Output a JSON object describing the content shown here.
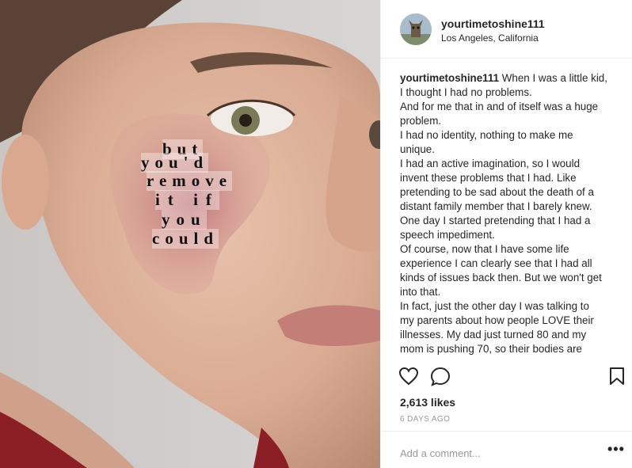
{
  "post": {
    "username": "yourtimetoshine111",
    "location": "Los Angeles, California",
    "image_overlay_words": [
      "but",
      "you'd",
      "remove",
      "it if",
      "you",
      "could"
    ],
    "caption_user": "yourtimetoshine111",
    "caption_lines": [
      "When I was a little kid,",
      "I thought I had no problems.",
      "And for me that in and of itself was a huge",
      "problem.",
      "I had no identity, nothing to make me",
      "unique.",
      "I had an active imagination, so I would",
      "invent these problems that I had. Like",
      "pretending to be sad about the death of a",
      "distant family member that I barely knew.",
      "One day I started pretending that I had a",
      "speech impediment.",
      "Of course, now that I have some life",
      "experience I can clearly see that I had all",
      "kinds of issues back then. But we won't get",
      "into that.",
      "In fact, just the other day I was talking to",
      "my parents about how people LOVE their",
      "illnesses. My dad just turned 80 and my",
      "mom is pushing 70, so their bodies are"
    ],
    "likes": "2,613 likes",
    "date": "6 DAYS AGO",
    "comment_placeholder": "Add a comment...",
    "more_label": "•••"
  },
  "icons": {
    "like": "heart-icon",
    "comment": "comment-icon",
    "save": "bookmark-icon",
    "more": "more-options-icon"
  }
}
